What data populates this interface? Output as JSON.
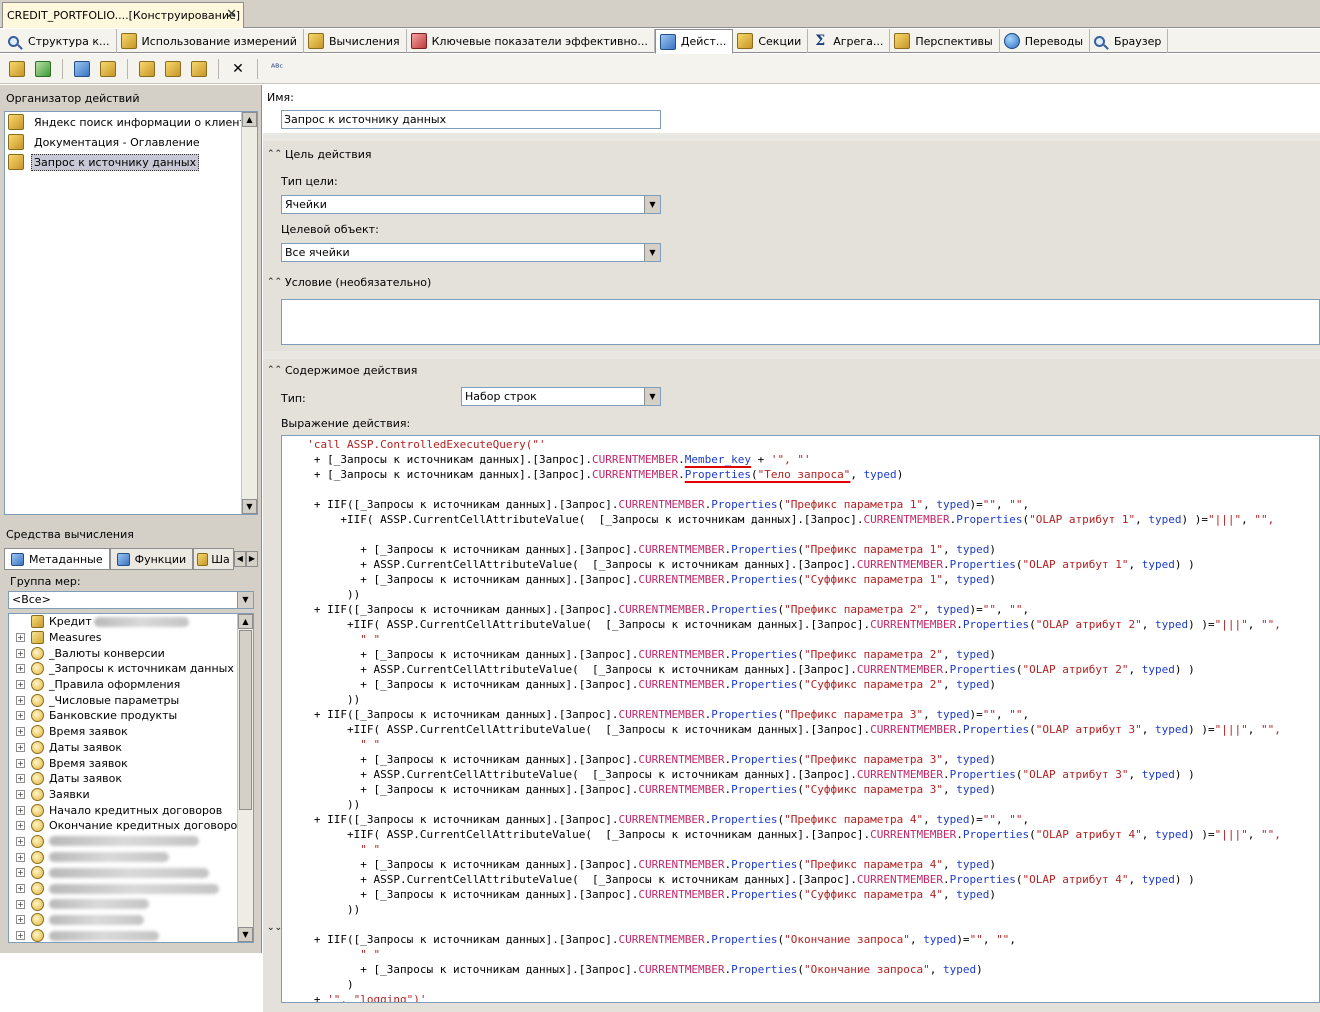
{
  "document_tab": {
    "title": "CREDIT_PORTFOLIO....[Конструирование]",
    "close": "✕"
  },
  "designer_tabs": [
    {
      "label": "Структура к...",
      "icon": "cube-structure-icon"
    },
    {
      "label": "Использование измерений",
      "icon": "dimension-usage-icon"
    },
    {
      "label": "Вычисления",
      "icon": "calculations-icon"
    },
    {
      "label": "Ключевые показатели эффективно...",
      "icon": "kpi-icon"
    },
    {
      "label": "Дейст...",
      "icon": "actions-icon",
      "active": true
    },
    {
      "label": "Секции",
      "icon": "partitions-icon"
    },
    {
      "label": "Агрега...",
      "icon": "aggregations-icon"
    },
    {
      "label": "Перспективы",
      "icon": "perspectives-icon"
    },
    {
      "label": "Переводы",
      "icon": "translations-icon"
    },
    {
      "label": "Браузер",
      "icon": "browser-icon"
    }
  ],
  "toolbar": {
    "buttons": [
      "process-icon",
      "reconnect-icon",
      "new-action-icon",
      "open-folder-icon",
      "new-drillthrough-icon",
      "new-report-action-icon",
      "copy-action-icon",
      "delete-icon",
      "spellcheck-icon"
    ],
    "delete_glyph": "✕",
    "spell_glyph": "ᴬᴮᶜ"
  },
  "organizer": {
    "header": "Организатор действий",
    "items": [
      {
        "label": "Яндекс поиск информации о клиенте"
      },
      {
        "label": "Документация - Оглавление"
      },
      {
        "label": "Запрос к источнику данных",
        "selected": true
      }
    ]
  },
  "calc_tools": {
    "header": "Средства вычисления",
    "tabs": [
      "Метаданные",
      "Функции",
      "Ша"
    ],
    "group_label": "Группа мер:",
    "group_value": "<Все>",
    "tree": [
      {
        "label": "Кредит",
        "icon": "cube",
        "root": true
      },
      {
        "label": "Measures",
        "icon": "measure"
      },
      {
        "label": "_Валюты конверсии",
        "icon": "dim"
      },
      {
        "label": "_Запросы к источникам данных",
        "icon": "dim"
      },
      {
        "label": "_Правила оформления",
        "icon": "dim"
      },
      {
        "label": "_Числовые параметры",
        "icon": "dim"
      },
      {
        "label": "Банковские продукты",
        "icon": "dim"
      },
      {
        "label": "Время заявок",
        "icon": "dim"
      },
      {
        "label": "Даты заявок",
        "icon": "dim"
      },
      {
        "label": "Время заявок",
        "icon": "dim"
      },
      {
        "label": "Даты заявок",
        "icon": "dim"
      },
      {
        "label": "Заявки",
        "icon": "dim"
      },
      {
        "label": "Начало кредитных договоров",
        "icon": "dim"
      },
      {
        "label": "Окончание кредитных договоров",
        "icon": "dim"
      }
    ],
    "expander": "+"
  },
  "form": {
    "name_label": "Имя:",
    "name_value": "Запрос к источнику данных",
    "target_section": "Цель действия",
    "target_type_label": "Тип цели:",
    "target_type_value": "Ячейки",
    "target_object_label": "Целевой объект:",
    "target_object_value": "Все ячейки",
    "condition_section": "Условие (необязательно)",
    "content_section": "Содержимое действия",
    "type_label": "Тип:",
    "type_value": "Набор строк",
    "expression_label": "Выражение действия:"
  },
  "chev": {
    "collapse": "⌃",
    "expand": "⌄"
  },
  "code": {
    "line1": "'call ASSP.ControlledExecuteQuery(\"'",
    "pre": "[_Запросы к источникам данных].[Запрос].",
    "cm": "CURRENTMEMBER",
    "prop": "Properties",
    "member_key": "Member_key",
    "body": "\"Тело запроса\"",
    "typed": "typed",
    "assp": "ASSP.CurrentCellAttributeValue(",
    "iif": "IIF(",
    "logging": "\"logging\"",
    "params": [
      {
        "prefix": "\"Префикс параметра 1\"",
        "olap": "\"OLAP атрибут 1\"",
        "suffix": "\"Суффикс параметра 1\""
      },
      {
        "prefix": "\"Префикс параметра 2\"",
        "olap": "\"OLAP атрибут 2\"",
        "suffix": "\"Суффикс параметра 2\""
      },
      {
        "prefix": "\"Префикс параметра 3\"",
        "olap": "\"OLAP атрибут 3\"",
        "suffix": "\"Суффикс параметра 3\""
      },
      {
        "prefix": "\"Префикс параметра 4\"",
        "olap": "\"OLAP атрибут 4\"",
        "suffix": "\"Суффикс параметра 4\""
      }
    ],
    "end_prop": "\"Окончание запроса\""
  }
}
